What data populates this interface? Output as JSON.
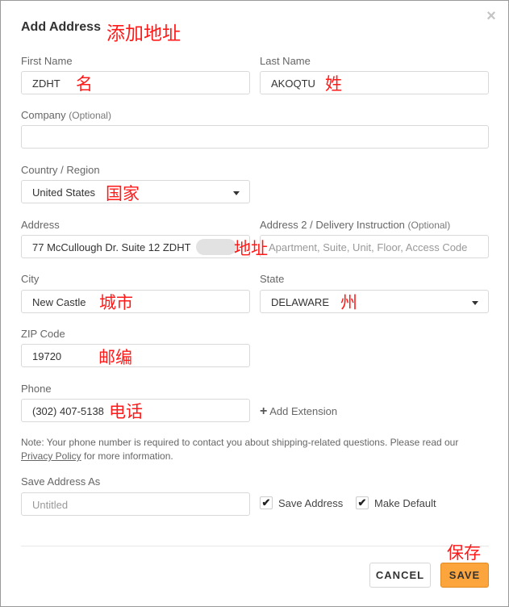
{
  "dialog": {
    "title": "Add Address",
    "close_icon": "close-icon"
  },
  "annotations": {
    "title": "添加地址",
    "first_name": "名",
    "last_name": "姓",
    "country": "国家",
    "address": "地址",
    "city": "城市",
    "state": "州",
    "zip": "邮编",
    "phone": "电话",
    "save": "保存"
  },
  "form": {
    "first_name": {
      "label": "First Name",
      "value": "ZDHT"
    },
    "last_name": {
      "label": "Last Name",
      "value": "AKOQTU"
    },
    "company": {
      "label": "Company",
      "optional": "(Optional)",
      "value": ""
    },
    "country": {
      "label": "Country / Region",
      "value": "United States"
    },
    "address": {
      "label": "Address",
      "value": "77 McCullough Dr. Suite 12 ZDHT"
    },
    "address2": {
      "label": "Address 2 / Delivery Instruction",
      "optional": "(Optional)",
      "placeholder": "Apartment, Suite, Unit, Floor, Access Code"
    },
    "city": {
      "label": "City",
      "value": "New Castle"
    },
    "state": {
      "label": "State",
      "value": "DELAWARE"
    },
    "zip": {
      "label": "ZIP Code",
      "value": "19720"
    },
    "phone": {
      "label": "Phone",
      "value": "(302) 407-5138"
    },
    "add_extension": "Add Extension",
    "note_text": "Note: Your phone number is required to contact you about shipping-related questions. Please read our",
    "privacy_link": "Privacy Policy",
    "note_suffix": "for more information.",
    "save_as": {
      "label": "Save Address As",
      "placeholder": "Untitled"
    },
    "save_address": {
      "label": "Save Address",
      "checked": true
    },
    "make_default": {
      "label": "Make Default",
      "checked": true
    }
  },
  "buttons": {
    "cancel": "CANCEL",
    "save": "SAVE"
  },
  "colors": {
    "save_button": "#fda53d",
    "annotation": "#ff1a1a"
  }
}
